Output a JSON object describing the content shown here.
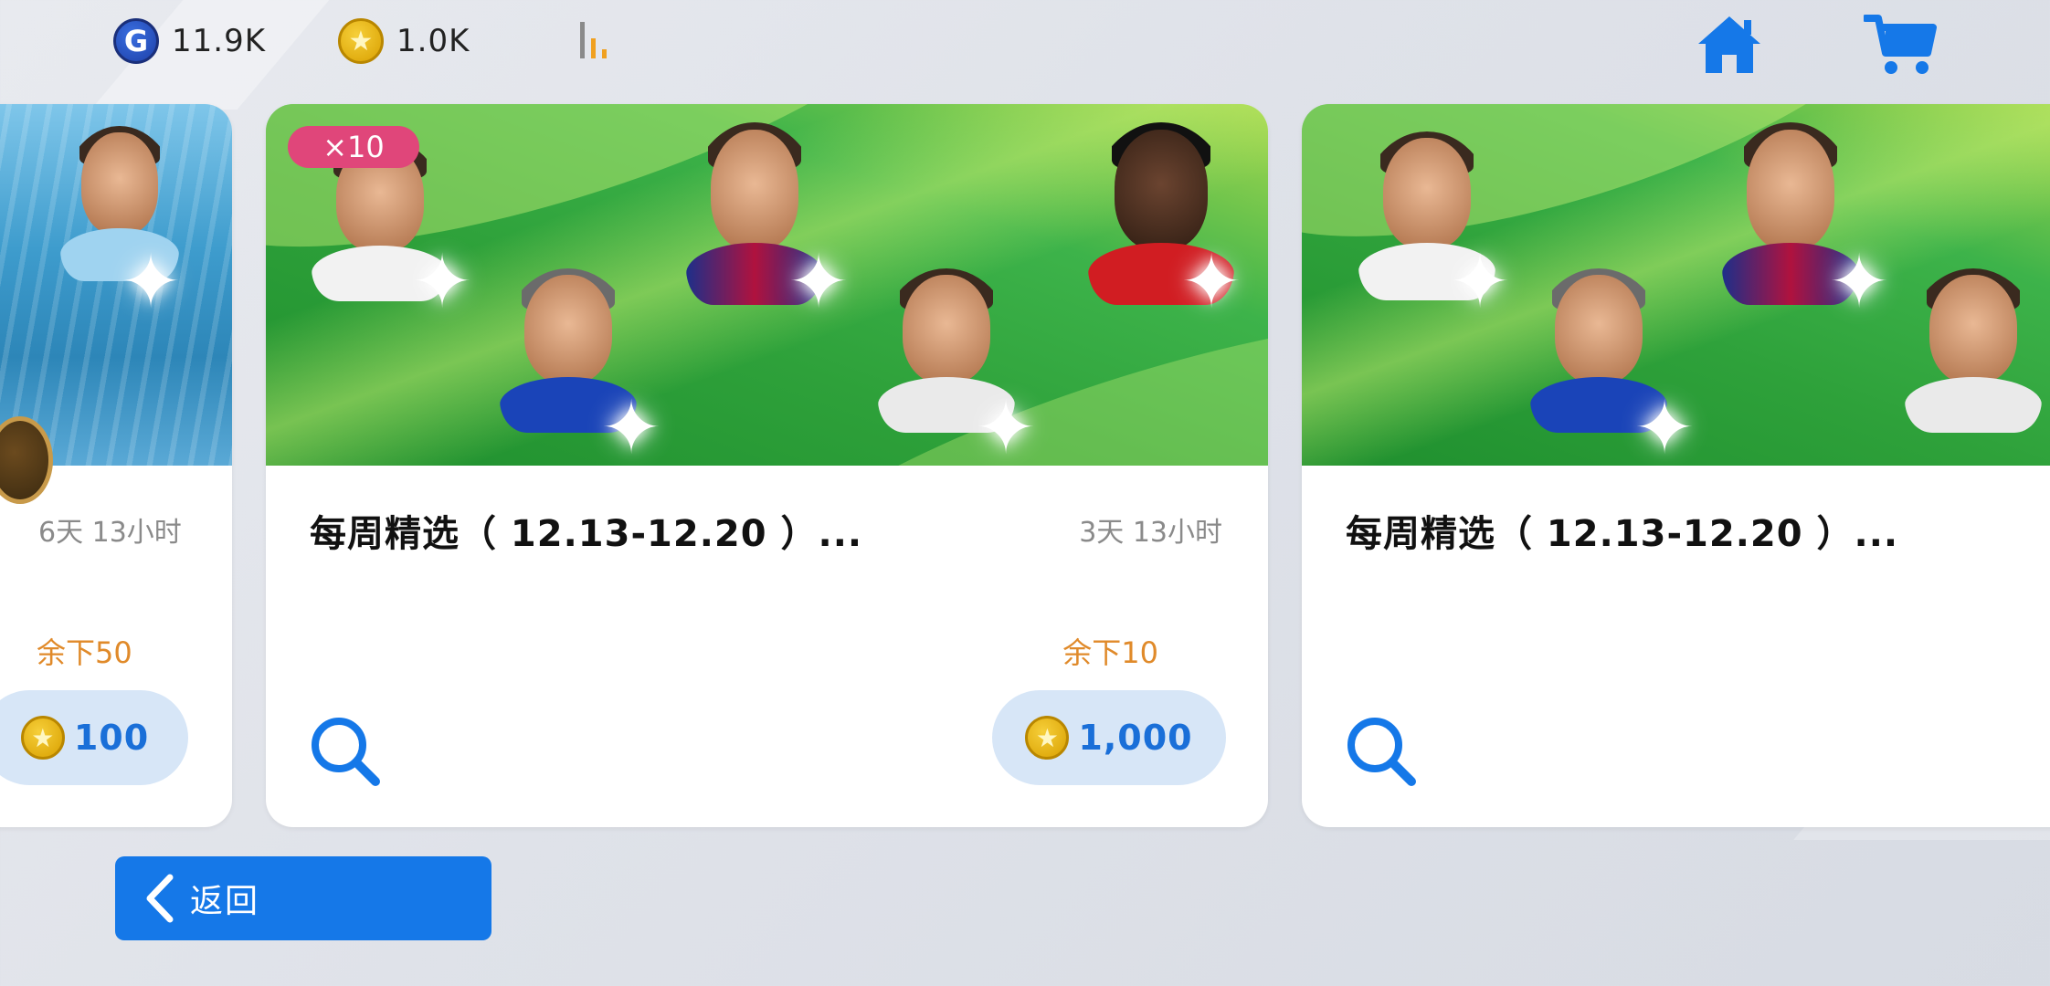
{
  "header": {
    "gp": {
      "icon": "gp-icon",
      "letter": "G",
      "value": "11.9K"
    },
    "coins": {
      "icon": "coin-icon",
      "value": "1.0K"
    },
    "signal": {
      "icon": "signal-strength-icon"
    },
    "home": {
      "icon": "home-icon"
    },
    "cart": {
      "icon": "cart-icon"
    }
  },
  "cards": [
    {
      "time_left": "6天 13小时",
      "remaining": "余下50",
      "price": "100"
    },
    {
      "badge": "×10",
      "title": "每周精选（ 12.13-12.20 ）...",
      "time_left": "3天 13小时",
      "remaining": "余下10",
      "price": "1,000"
    },
    {
      "title": "每周精选（ 12.13-12.20 ）..."
    }
  ],
  "footer": {
    "back_label": "返回"
  },
  "colors": {
    "accent_blue": "#1578e8",
    "price_bg": "#d7e6f7",
    "remaining_orange": "#e08a2a",
    "badge_pink": "#e0467a",
    "coin_gold": "#d9a000"
  }
}
